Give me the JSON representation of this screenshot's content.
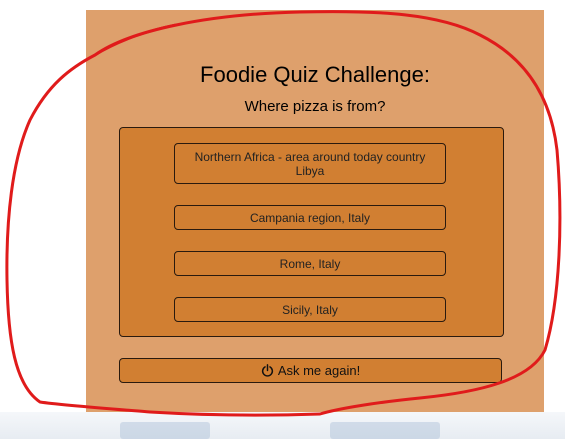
{
  "quiz": {
    "title": "Foodie Quiz Challenge:",
    "question": "Where pizza is from?",
    "answers": [
      "Northern Africa - area around today country Libya",
      "Campania region, Italy",
      "Rome, Italy",
      "Sicily, Italy"
    ],
    "again_label": "Ask me again!",
    "again_icon": "power-icon"
  },
  "colors": {
    "card": "#dea06c",
    "panel": "#d17f32",
    "annotation": "#e01b1b"
  }
}
